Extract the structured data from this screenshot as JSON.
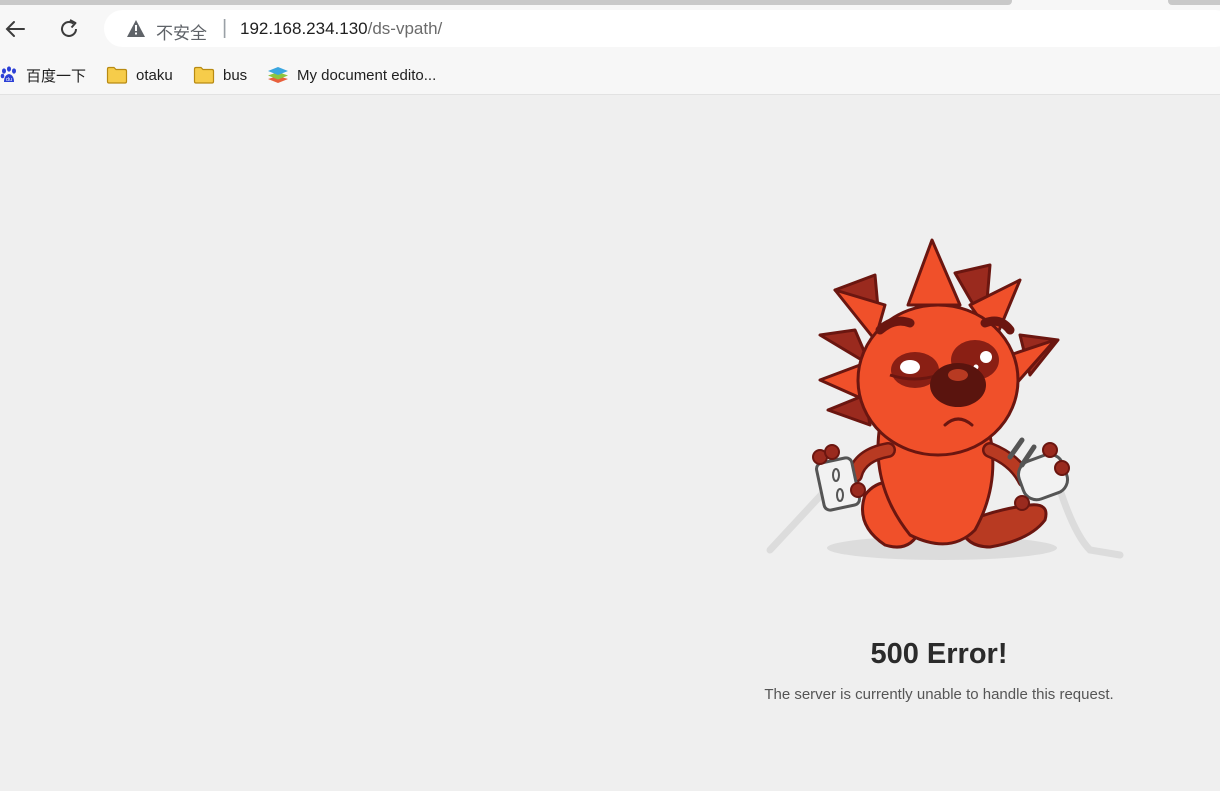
{
  "browser": {
    "security_label": "不安全",
    "url_host": "192.168.234.130",
    "url_path": "/ds-vpath/",
    "back_icon": "arrow-left-icon",
    "reload_icon": "reload-icon",
    "warning_icon": "warning-triangle-icon"
  },
  "bookmarks": [
    {
      "label": "百度一下",
      "icon": "baidu-paw-icon"
    },
    {
      "label": "otaku",
      "icon": "folder-icon"
    },
    {
      "label": "bus",
      "icon": "folder-icon"
    },
    {
      "label": "My document edito...",
      "icon": "layers-icon"
    }
  ],
  "error": {
    "title": "500 Error!",
    "message": "The server is currently unable to handle this request."
  },
  "colors": {
    "mascot_orange": "#f0502a",
    "mascot_dark": "#8a1f14",
    "folder": "#f6cc4a",
    "page_bg": "#efefef"
  }
}
